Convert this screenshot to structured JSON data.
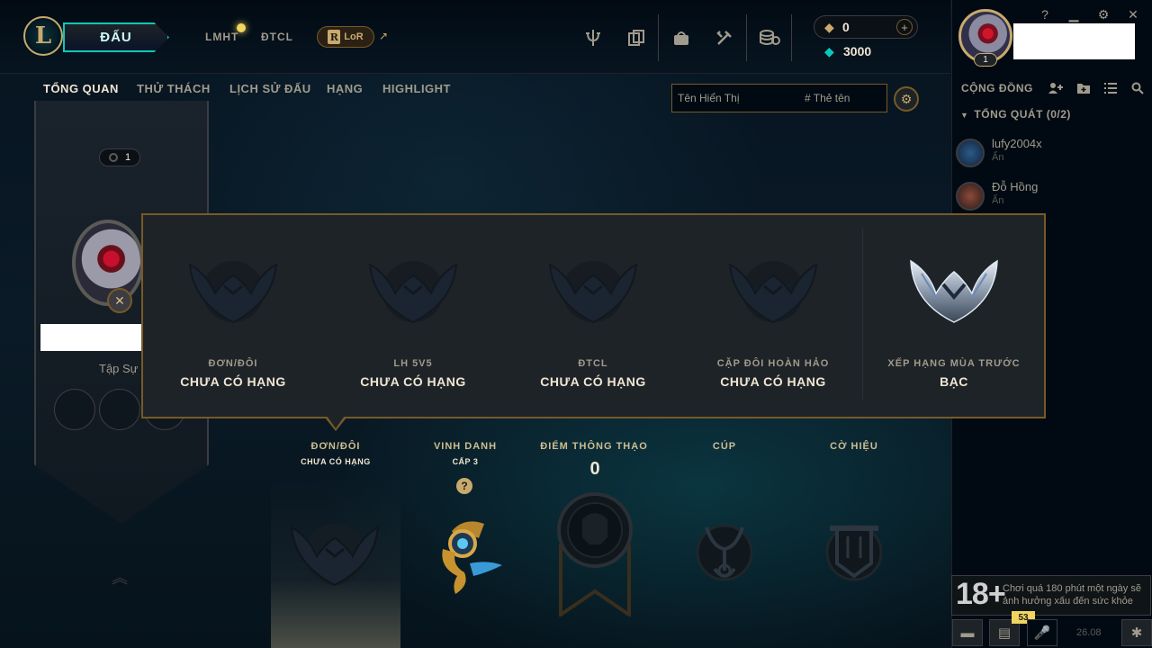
{
  "topbar": {
    "play_label": "ĐẤU",
    "nav": [
      "LMHT",
      "ĐTCL"
    ],
    "lor_label": "LoR",
    "lor_badge": "R",
    "lor_ext": "↗",
    "rp_value": "0",
    "be_value": "3000",
    "rp_plus": "+",
    "icons": [
      "trophy-icon",
      "collection-icon",
      "loot-icon",
      "crafting-icon",
      "store-icon"
    ]
  },
  "window": {
    "help": "?",
    "minimize": "▁",
    "settings": "⚙",
    "close": "✕"
  },
  "profile": {
    "level": "1"
  },
  "subnav": {
    "tabs": [
      "TỔNG QUAN",
      "THỬ THÁCH",
      "LỊCH SỬ ĐẤU",
      "HẠNG",
      "HIGHLIGHT"
    ],
    "search_placeholder": "Tên Hiển Thị",
    "tag_placeholder": "# Thẻ tên"
  },
  "banner": {
    "level": "1",
    "rank_title": "Tập Sự"
  },
  "popup": {
    "ranks": [
      {
        "queue": "ĐƠN/ĐÔI",
        "tier": "CHƯA CÓ HẠNG"
      },
      {
        "queue": "LH 5V5",
        "tier": "CHƯA CÓ HẠNG"
      },
      {
        "queue": "ĐTCL",
        "tier": "CHƯA CÓ HẠNG"
      },
      {
        "queue": "CẶP ĐÔI HOÀN HẢO",
        "tier": "CHƯA CÓ HẠNG"
      },
      {
        "queue": "XẾP HẠNG MÙA TRƯỚC",
        "tier": "BẠC"
      }
    ]
  },
  "stats": {
    "solo_label": "ĐƠN/ĐÔI",
    "solo_sub": "CHƯA CÓ HẠNG",
    "honor_label": "VINH DANH",
    "honor_sub": "CẤP 3",
    "honor_help": "?",
    "mastery_label": "ĐIỂM THÔNG THẠO",
    "mastery_value": "0",
    "trophy_label": "CÚP",
    "banner_label": "CỜ HIỆU"
  },
  "social": {
    "title": "CỘNG ĐỒNG",
    "group": "TỔNG QUÁT (0/2)",
    "friends": [
      {
        "name": "lufy2004x",
        "status": "Ẩn"
      },
      {
        "name": "Đỗ Hồng",
        "status": "Ẩn"
      }
    ],
    "warning_badge": "18+",
    "warning_text": "Chơi quá 180 phút một ngày sẽ ảnh hưởng xấu đến sức khỏe",
    "chat_count": "53",
    "version": "26.08"
  },
  "colors": {
    "gold": "#c8aa6e",
    "teal": "#0ac8b9",
    "background": "#010a13"
  }
}
